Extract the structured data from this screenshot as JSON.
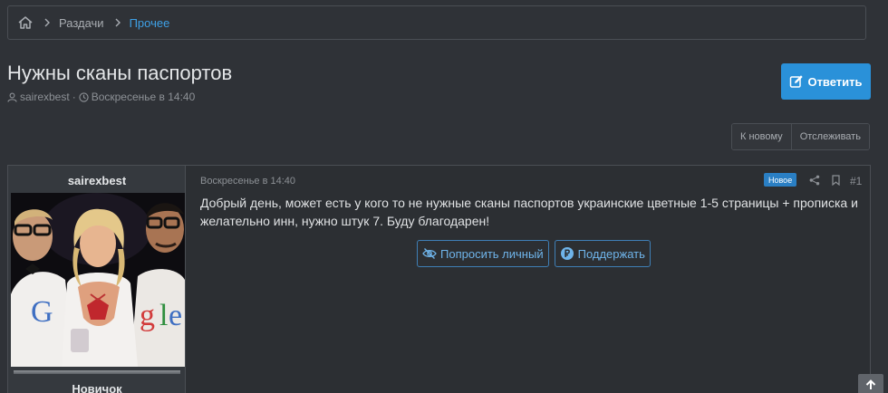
{
  "breadcrumb": {
    "items": [
      {
        "label": "Раздачи"
      },
      {
        "label": "Прочее"
      }
    ]
  },
  "thread": {
    "title": "Нужны сканы паспортов",
    "author": "sairexbest",
    "separator": "·",
    "date": "Воскресенье в 14:40",
    "reply_label": "Ответить",
    "to_new_label": "К новому",
    "watch_label": "Отслеживать"
  },
  "post": {
    "username": "sairexbest",
    "rank": "Новичок",
    "date": "Воскресенье в 14:40",
    "badge": "Новое",
    "number": "#1",
    "text": "Добрый день, может есть у кого то не нужные сканы паспортов украинские цветные 1-5 страницы + прописка и желательно инн, нужно штук 7. Буду благодарен!",
    "request_label": "Попросить личный",
    "support_label": "Поддержать"
  },
  "colors": {
    "background": "#2f3237",
    "accent": "#2a91d9",
    "link": "#3ea0e6"
  },
  "icons": [
    "home-icon",
    "chevron-right-icon",
    "user-icon",
    "clock-icon",
    "edit-icon",
    "share-icon",
    "bookmark-icon",
    "eye-off-icon",
    "ruble-icon",
    "arrow-up-icon"
  ]
}
